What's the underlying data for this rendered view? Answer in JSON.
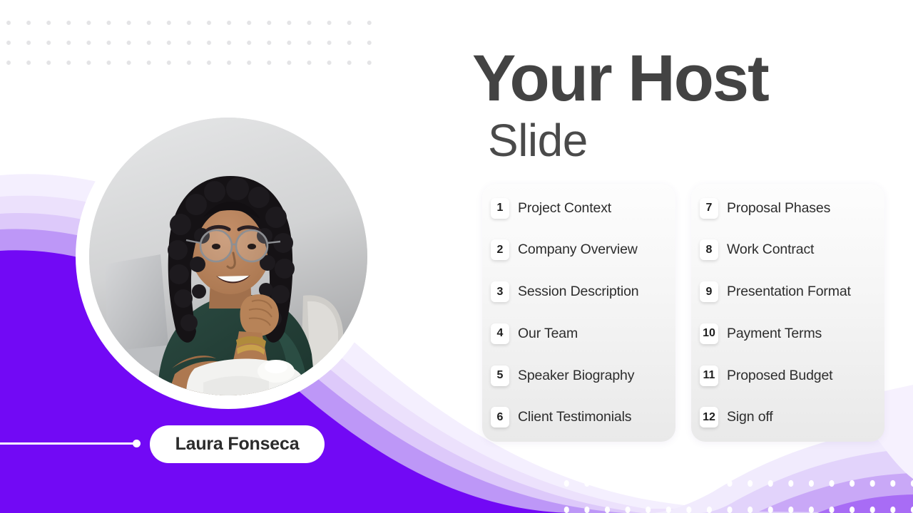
{
  "slide": {
    "title_main": "Your Host",
    "title_sub": "Slide",
    "speaker_name": "Laura Fonseca"
  },
  "colors": {
    "brand_purple": "#7209f5",
    "purple_mid": "#a86cf5",
    "purple_light": "#c9a8f7",
    "lavender": "#e2d3fb",
    "lavender_pale": "#f1ebfd",
    "title_gray": "#434343",
    "panel_gradient_top": "#fdfdfd",
    "panel_gradient_bottom": "#e9e9e9",
    "dot_gray": "#e4e4e6",
    "dot_white": "#ffffff",
    "label_text": "#2d2d2d"
  },
  "photo": {
    "alt": "portrait-photo-smiling-woman-with-curly-hair-glasses-at-laptop",
    "background": "#d9dadb",
    "shirt": "#26413a",
    "skin": "#b5825f",
    "hair": "#1a1618"
  },
  "agenda": {
    "columns": [
      {
        "items": [
          {
            "number": "1",
            "label": "Project Context"
          },
          {
            "number": "2",
            "label": "Company Overview"
          },
          {
            "number": "3",
            "label": "Session Description"
          },
          {
            "number": "4",
            "label": "Our Team"
          },
          {
            "number": "5",
            "label": "Speaker Biography"
          },
          {
            "number": "6",
            "label": "Client Testimonials"
          }
        ]
      },
      {
        "items": [
          {
            "number": "7",
            "label": "Proposal Phases"
          },
          {
            "number": "8",
            "label": "Work Contract"
          },
          {
            "number": "9",
            "label": "Presentation Format"
          },
          {
            "number": "10",
            "label": "Payment Terms"
          },
          {
            "number": "11",
            "label": "Proposed Budget"
          },
          {
            "number": "12",
            "label": "Sign off"
          }
        ]
      }
    ]
  }
}
